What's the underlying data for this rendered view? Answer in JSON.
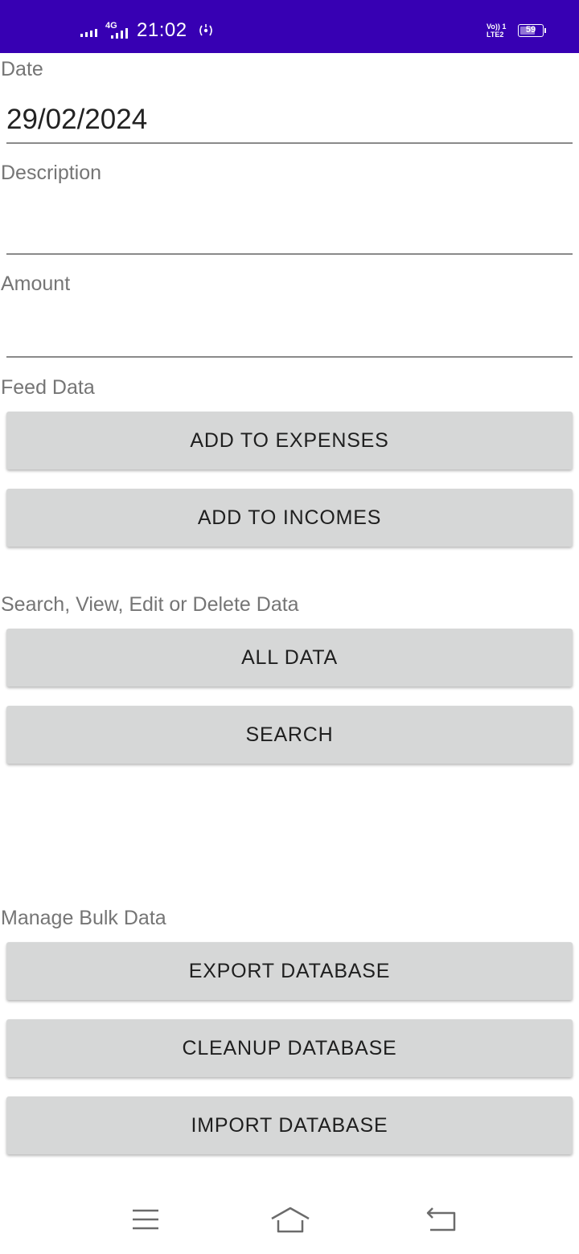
{
  "status_bar": {
    "network_type": "4G",
    "time": "21:02",
    "volte_line1": "Vo)) 1",
    "volte_line2": "LTE2",
    "battery": "59",
    "background_color": "#3700b3"
  },
  "date": {
    "label": "Date",
    "value": "29/02/2024"
  },
  "description": {
    "label": "Description",
    "value": ""
  },
  "amount": {
    "label": "Amount",
    "value": ""
  },
  "feed_data": {
    "label": "Feed Data",
    "add_expenses": "ADD TO EXPENSES",
    "add_incomes": "ADD TO INCOMES"
  },
  "search_view": {
    "label": "Search, View, Edit or Delete Data",
    "all_data": "ALL DATA",
    "search": "SEARCH"
  },
  "bulk": {
    "label": "Manage Bulk Data",
    "export": "EXPORT DATABASE",
    "cleanup": "CLEANUP DATABASE",
    "import": "IMPORT DATABASE"
  },
  "nav_bar": {
    "icons": [
      "menu-icon",
      "home-icon",
      "back-icon"
    ]
  }
}
